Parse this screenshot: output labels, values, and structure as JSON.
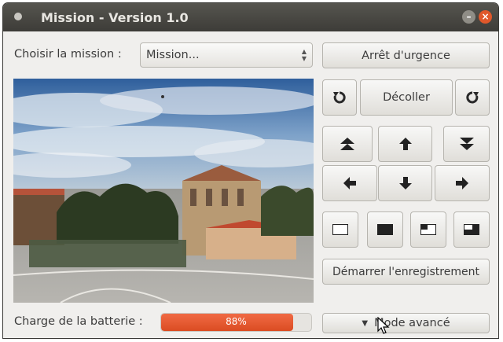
{
  "window": {
    "title": "Mission - Version 1.0"
  },
  "mission": {
    "label": "Choisir la mission :",
    "selected": "Mission..."
  },
  "buttons": {
    "emergency": "Arrêt d'urgence",
    "takeoff": "Décoller",
    "record": "Démarrer l'enregistrement",
    "advanced": "Mode avancé"
  },
  "battery": {
    "label": "Charge de la batterie :",
    "percent_text": "88%",
    "level": 0.88
  },
  "icons": {
    "rotate_left": "rotate-counterclockwise-icon",
    "rotate_right": "rotate-clockwise-icon",
    "up": "ascend-icon",
    "forward": "arrow-up-icon",
    "down": "descend-icon",
    "left": "arrow-left-icon",
    "back": "arrow-down-icon",
    "right": "arrow-right-icon",
    "view_empty": "view-empty-icon",
    "view_full": "view-full-icon",
    "view_pip_left": "view-pip-left-icon",
    "view_pip_right": "view-pip-right-icon"
  },
  "colors": {
    "accent": "#e0582b",
    "titlebar": "#3d3c38"
  }
}
